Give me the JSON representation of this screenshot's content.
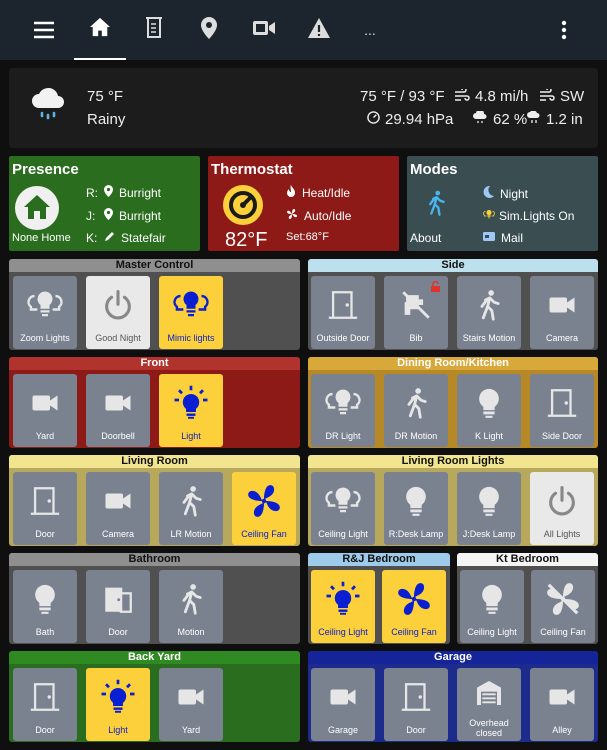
{
  "toolbar": {
    "more_label": "..."
  },
  "weather": {
    "temperature": "75 °F",
    "condition": "Rainy",
    "temp_range": "75 °F / 93 °F",
    "wind_speed": "4.8 mi/h",
    "wind_direction": "SW",
    "pressure": "29.94 hPa",
    "humidity": "62 %",
    "precipitation": "1.2 in"
  },
  "presence": {
    "title": "Presence",
    "status": "None Home",
    "rows": [
      {
        "key": "R:",
        "value": "Burright"
      },
      {
        "key": "J:",
        "value": "Burright"
      },
      {
        "key": "K:",
        "value": "Statefair"
      }
    ]
  },
  "thermostat": {
    "title": "Thermostat",
    "temperature": "82°F",
    "mode": "Heat/Idle",
    "fan": "Auto/Idle",
    "setpoint": "Set:68°F"
  },
  "modes": {
    "title": "Modes",
    "status": "About",
    "night": "Night",
    "sim_lights": "Sim.Lights On",
    "mail": "Mail"
  },
  "groups": {
    "master": {
      "title": "Master Control",
      "tiles": [
        "Zoom Lights",
        "Good Night",
        "Mimic lights"
      ]
    },
    "side": {
      "title": "Side",
      "tiles": [
        "Outside Door",
        "Bib",
        "Stairs Motion",
        "Camera"
      ]
    },
    "front": {
      "title": "Front",
      "tiles": [
        "Yard",
        "Doorbell",
        "Light"
      ]
    },
    "dining": {
      "title": "Dining Room/Kitchen",
      "tiles": [
        "DR Light",
        "DR Motion",
        "K Light",
        "Side Door"
      ]
    },
    "living": {
      "title": "Living Room",
      "tiles": [
        "Door",
        "Camera",
        "LR Motion",
        "Ceiling Fan"
      ]
    },
    "living_lights": {
      "title": "Living Room Lights",
      "tiles": [
        "Ceiling Light",
        "R:Desk Lamp",
        "J:Desk Lamp",
        "All Lights"
      ]
    },
    "bathroom": {
      "title": "Bathroom",
      "tiles": [
        "Bath",
        "Door",
        "Motion"
      ]
    },
    "rj": {
      "title": "R&J Bedroom",
      "tiles": [
        "Ceiling Light",
        "Ceiling Fan"
      ]
    },
    "kt": {
      "title": "Kt Bedroom",
      "tiles": [
        "Ceiling Light",
        "Ceiling Fan"
      ]
    },
    "backyard": {
      "title": "Back Yard",
      "tiles": [
        "Door",
        "Light",
        "Yard"
      ]
    },
    "garage": {
      "title": "Garage",
      "tiles": [
        "Garage",
        "Door",
        "Overhead closed",
        "Alley"
      ]
    }
  },
  "colors": {
    "toolbar": "#1c252d",
    "tile_off": "#7a8290",
    "tile_on": "#fbd03a",
    "icon_on": "#0a1fd1",
    "presence": "#2a6d1f",
    "thermostat": "#8e1a17",
    "modes": "#3a4e52"
  }
}
